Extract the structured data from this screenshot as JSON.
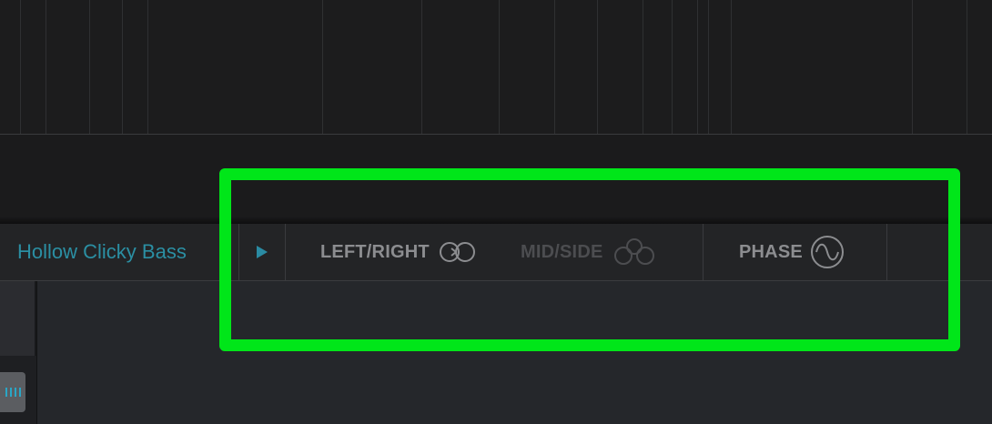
{
  "toolbar": {
    "preset_name": "Hollow Clicky Bass",
    "tabs": [
      {
        "label": "LEFT/RIGHT",
        "icon": "left-right-circles-icon",
        "state": "active"
      },
      {
        "label": "MID/SIDE",
        "icon": "mid-side-circles-icon",
        "state": "dimmed"
      },
      {
        "label": "PHASE",
        "icon": "sine-wave-icon",
        "state": "active"
      }
    ]
  },
  "colors": {
    "preset_text": "#2b8fa3",
    "play_icon": "#2a8ba3",
    "tab_active": "#8c8d90",
    "tab_dimmed": "#4c4d50",
    "highlight": "#00e619",
    "fader_grip": "#2aa6c6"
  }
}
